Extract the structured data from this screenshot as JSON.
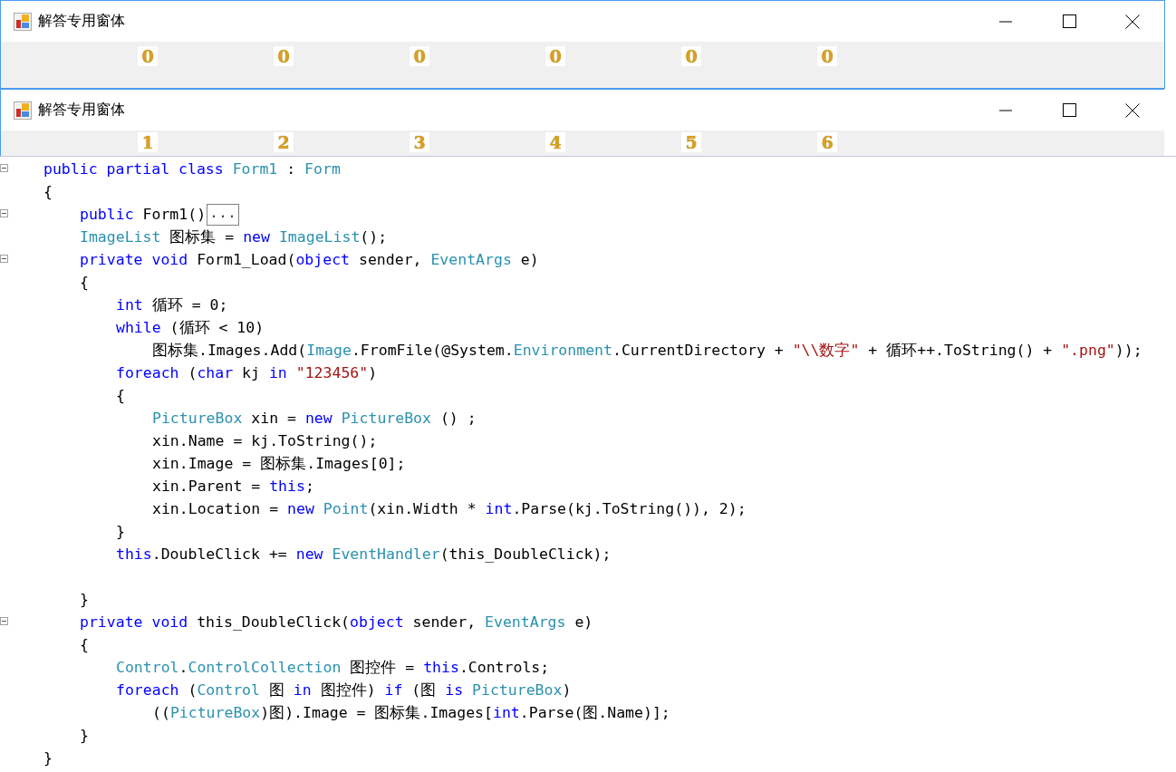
{
  "windows": [
    {
      "title": "解答专用窗体",
      "digits": [
        "0",
        "0",
        "0",
        "0",
        "0",
        "0"
      ]
    },
    {
      "title": "解答专用窗体",
      "digits": [
        "1",
        "2",
        "3",
        "4",
        "5",
        "6"
      ]
    }
  ],
  "code": {
    "lines": [
      {
        "fold": true,
        "tokens": [
          {
            "kind": "kw",
            "text": "public partial class "
          },
          {
            "kind": "type",
            "text": "Form1"
          },
          {
            "kind": "plain",
            "text": " : "
          },
          {
            "kind": "type",
            "text": "Form"
          }
        ]
      },
      {
        "fold": false,
        "tokens": [
          {
            "kind": "plain",
            "text": "{"
          }
        ],
        "children": [
          {
            "fold": true,
            "tokens": [
              {
                "kind": "kw",
                "text": "public "
              },
              {
                "kind": "plain",
                "text": "Form1()"
              }
            ],
            "collapsed": "..."
          },
          {
            "fold": false,
            "tokens": [
              {
                "kind": "type",
                "text": "ImageList"
              },
              {
                "kind": "plain",
                "text": " 图标集 = "
              },
              {
                "kind": "kw",
                "text": "new "
              },
              {
                "kind": "type",
                "text": "ImageList"
              },
              {
                "kind": "plain",
                "text": "();"
              }
            ]
          },
          {
            "fold": true,
            "tokens": [
              {
                "kind": "kw",
                "text": "private void "
              },
              {
                "kind": "plain",
                "text": "Form1_Load("
              },
              {
                "kind": "kw",
                "text": "object"
              },
              {
                "kind": "plain",
                "text": " sender, "
              },
              {
                "kind": "type",
                "text": "EventArgs"
              },
              {
                "kind": "plain",
                "text": " e)"
              }
            ]
          },
          {
            "fold": false,
            "tokens": [
              {
                "kind": "plain",
                "text": "{"
              }
            ],
            "children": [
              {
                "fold": false,
                "tokens": [
                  {
                    "kind": "kw",
                    "text": "int"
                  },
                  {
                    "kind": "plain",
                    "text": " 循环 = 0;"
                  }
                ]
              },
              {
                "fold": false,
                "tokens": [
                  {
                    "kind": "kw",
                    "text": "while"
                  },
                  {
                    "kind": "plain",
                    "text": " (循环 < 10)"
                  }
                ],
                "children": [
                  {
                    "fold": false,
                    "tokens": [
                      {
                        "kind": "plain",
                        "text": "图标集.Images.Add("
                      },
                      {
                        "kind": "type",
                        "text": "Image"
                      },
                      {
                        "kind": "plain",
                        "text": ".FromFile(@System."
                      },
                      {
                        "kind": "type",
                        "text": "Environment"
                      },
                      {
                        "kind": "plain",
                        "text": ".CurrentDirectory + "
                      },
                      {
                        "kind": "str",
                        "text": "\"\\\\数字\""
                      },
                      {
                        "kind": "plain",
                        "text": " + 循环++.ToString() + "
                      },
                      {
                        "kind": "str",
                        "text": "\".png\""
                      },
                      {
                        "kind": "plain",
                        "text": "));"
                      }
                    ]
                  }
                ]
              },
              {
                "fold": false,
                "tokens": [
                  {
                    "kind": "kw",
                    "text": "foreach"
                  },
                  {
                    "kind": "plain",
                    "text": " ("
                  },
                  {
                    "kind": "kw",
                    "text": "char"
                  },
                  {
                    "kind": "plain",
                    "text": " kj "
                  },
                  {
                    "kind": "kw",
                    "text": "in "
                  },
                  {
                    "kind": "str",
                    "text": "\"123456\""
                  },
                  {
                    "kind": "plain",
                    "text": ")"
                  }
                ]
              },
              {
                "fold": false,
                "tokens": [
                  {
                    "kind": "plain",
                    "text": "{"
                  }
                ],
                "children": [
                  {
                    "fold": false,
                    "tokens": [
                      {
                        "kind": "type",
                        "text": "PictureBox"
                      },
                      {
                        "kind": "plain",
                        "text": " xin = "
                      },
                      {
                        "kind": "kw",
                        "text": "new "
                      },
                      {
                        "kind": "type",
                        "text": "PictureBox"
                      },
                      {
                        "kind": "plain",
                        "text": " () ;"
                      }
                    ]
                  },
                  {
                    "fold": false,
                    "tokens": [
                      {
                        "kind": "plain",
                        "text": "xin.Name = kj.ToString();"
                      }
                    ]
                  },
                  {
                    "fold": false,
                    "tokens": [
                      {
                        "kind": "plain",
                        "text": "xin.Image = 图标集.Images[0];"
                      }
                    ]
                  },
                  {
                    "fold": false,
                    "tokens": [
                      {
                        "kind": "plain",
                        "text": "xin.Parent = "
                      },
                      {
                        "kind": "kw",
                        "text": "this"
                      },
                      {
                        "kind": "plain",
                        "text": ";"
                      }
                    ]
                  },
                  {
                    "fold": false,
                    "tokens": [
                      {
                        "kind": "plain",
                        "text": "xin.Location = "
                      },
                      {
                        "kind": "kw",
                        "text": "new "
                      },
                      {
                        "kind": "type",
                        "text": "Point"
                      },
                      {
                        "kind": "plain",
                        "text": "(xin.Width * "
                      },
                      {
                        "kind": "kw",
                        "text": "int"
                      },
                      {
                        "kind": "plain",
                        "text": ".Parse(kj.ToString()), 2);"
                      }
                    ]
                  }
                ]
              },
              {
                "fold": false,
                "tokens": [
                  {
                    "kind": "plain",
                    "text": "}"
                  }
                ]
              },
              {
                "fold": false,
                "tokens": [
                  {
                    "kind": "kw",
                    "text": "this"
                  },
                  {
                    "kind": "plain",
                    "text": ".DoubleClick += "
                  },
                  {
                    "kind": "kw",
                    "text": "new "
                  },
                  {
                    "kind": "type",
                    "text": "EventHandler"
                  },
                  {
                    "kind": "plain",
                    "text": "(this_DoubleClick);"
                  }
                ]
              },
              {
                "fold": false
              }
            ]
          },
          {
            "fold": false,
            "tokens": [
              {
                "kind": "plain",
                "text": "}"
              }
            ]
          },
          {
            "fold": true,
            "tokens": [
              {
                "kind": "kw",
                "text": "private void "
              },
              {
                "kind": "plain",
                "text": "this_DoubleClick("
              },
              {
                "kind": "kw",
                "text": "object"
              },
              {
                "kind": "plain",
                "text": " sender, "
              },
              {
                "kind": "type",
                "text": "EventArgs"
              },
              {
                "kind": "plain",
                "text": " e)"
              }
            ]
          },
          {
            "fold": false,
            "tokens": [
              {
                "kind": "plain",
                "text": "{"
              }
            ],
            "children": [
              {
                "fold": false,
                "tokens": [
                  {
                    "kind": "type",
                    "text": "Control"
                  },
                  {
                    "kind": "plain",
                    "text": "."
                  },
                  {
                    "kind": "type",
                    "text": "ControlCollection"
                  },
                  {
                    "kind": "plain",
                    "text": " 图控件 = "
                  },
                  {
                    "kind": "kw",
                    "text": "this"
                  },
                  {
                    "kind": "plain",
                    "text": ".Controls;"
                  }
                ]
              },
              {
                "fold": false,
                "tokens": [
                  {
                    "kind": "kw",
                    "text": "foreach"
                  },
                  {
                    "kind": "plain",
                    "text": " ("
                  },
                  {
                    "kind": "type",
                    "text": "Control"
                  },
                  {
                    "kind": "plain",
                    "text": " 图 "
                  },
                  {
                    "kind": "kw",
                    "text": "in"
                  },
                  {
                    "kind": "plain",
                    "text": " 图控件) "
                  },
                  {
                    "kind": "kw",
                    "text": "if"
                  },
                  {
                    "kind": "plain",
                    "text": " (图 "
                  },
                  {
                    "kind": "kw",
                    "text": "is "
                  },
                  {
                    "kind": "type",
                    "text": "PictureBox"
                  },
                  {
                    "kind": "plain",
                    "text": ")"
                  }
                ],
                "children": [
                  {
                    "fold": false,
                    "tokens": [
                      {
                        "kind": "plain",
                        "text": "(("
                      },
                      {
                        "kind": "type",
                        "text": "PictureBox"
                      },
                      {
                        "kind": "plain",
                        "text": ")图).Image = 图标集.Images["
                      },
                      {
                        "kind": "kw",
                        "text": "int"
                      },
                      {
                        "kind": "plain",
                        "text": ".Parse(图.Name)];"
                      }
                    ]
                  }
                ]
              }
            ]
          },
          {
            "fold": false,
            "tokens": [
              {
                "kind": "plain",
                "text": "}"
              }
            ]
          }
        ]
      },
      {
        "fold": false,
        "tokens": [
          {
            "kind": "plain",
            "text": "}"
          }
        ]
      }
    ]
  }
}
